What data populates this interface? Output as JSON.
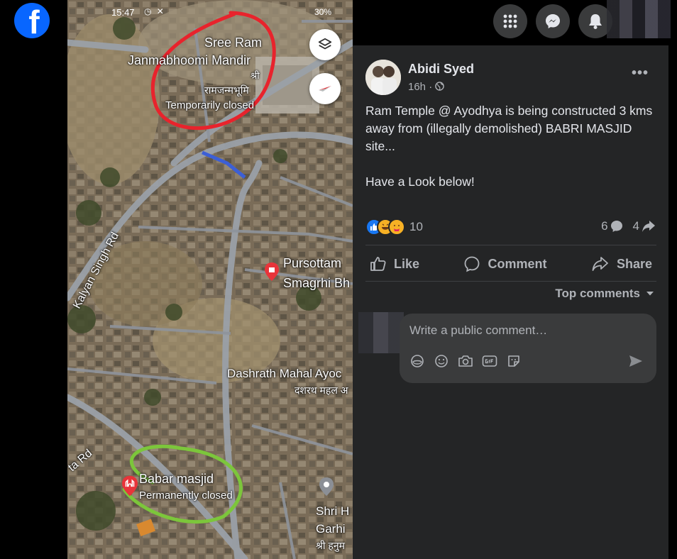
{
  "brand": {
    "logo_letter": "f",
    "color": "#0866ff"
  },
  "photo": {
    "status_bar": {
      "time": "15:47",
      "battery": "30%"
    },
    "map_labels": {
      "temple_name_line1": "Sree Ram",
      "temple_name_line2": "Janmabhoomi Mandir",
      "temple_hindi": "रामजन्मभूमि",
      "temple_hindi_short": "श्री",
      "temple_status": "Temporarily closed",
      "road_kalyan": "Kalyan Singh Rd",
      "pursottam_line1": "Pursottam",
      "pursottam_line2": "Smagrhi Bh",
      "dashrath": "Dashrath Mahal Ayoc",
      "dashrath_hindi": "दशरथ महल अ",
      "babar_name": "Babar masjid",
      "babar_status": "Permanently closed",
      "road_left": "ta Rd",
      "shri_line1": "Shri H",
      "shri_line2": "Garhi",
      "shri_hindi": "श्री हनुम"
    },
    "annotation_colors": {
      "red_circle": "#e8232c",
      "green_circle": "#7cc63b"
    }
  },
  "topbar": {
    "menu_icon": "grid-menu-icon",
    "messenger_icon": "messenger-icon",
    "notifications_icon": "bell-icon"
  },
  "post": {
    "author": "Abidi Syed",
    "time": "16h ·",
    "text": "Ram Temple @ Ayodhya is being constructed 3 kms away from (illegally demolished) BABRI MASJID site...\n\nHave a Look below!",
    "reactions_count": "10",
    "comments_count": "6",
    "shares_count": "4",
    "actions": {
      "like": "Like",
      "comment": "Comment",
      "share": "Share"
    },
    "top_comments": "Top comments",
    "comment_placeholder": "Write a public comment…"
  }
}
